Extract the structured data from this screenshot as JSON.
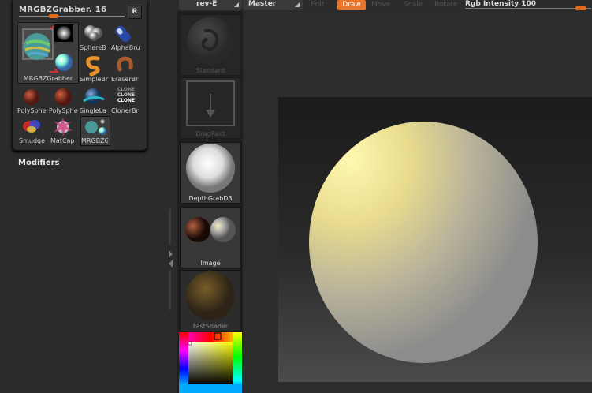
{
  "brush_panel": {
    "title": "MRGBZGrabber. 16",
    "r_button": "R",
    "items": [
      {
        "label": "MRGBZGrabber",
        "icon": "mrgbz-grabber-icon"
      },
      {
        "label": "SphereB",
        "icon": "sphere-brush-icon"
      },
      {
        "label": "AlphaBru",
        "icon": "alpha-brush-icon"
      },
      {
        "label": "SimpleBr",
        "icon": "simple-brush-icon"
      },
      {
        "label": "EraserBr",
        "icon": "eraser-brush-icon"
      },
      {
        "label": "PolySphe",
        "icon": "polysphere-icon"
      },
      {
        "label": "PolySphe",
        "icon": "polysphere-icon"
      },
      {
        "label": "SingleLa",
        "icon": "single-layer-icon"
      },
      {
        "label": "ClonerBr",
        "icon": "cloner-brush-icon"
      },
      {
        "label": "Smudge",
        "icon": "smudge-icon"
      },
      {
        "label": "MatCap",
        "icon": "matcap-icon"
      },
      {
        "label": "MRGBZG",
        "icon": "mrgbz-grabber-small-icon"
      }
    ],
    "clone_text": [
      "CLONE",
      "CLONE",
      "CLONE"
    ]
  },
  "modifiers_label": "Modifiers",
  "materials": {
    "dropdown": "rev-E",
    "items": [
      {
        "label": "Standard"
      },
      {
        "label": "DragRect"
      },
      {
        "label": "DepthGrabD3"
      },
      {
        "label": "Image"
      },
      {
        "label": "FastShader"
      }
    ]
  },
  "toolbar": {
    "master": "Master",
    "edit": "Edit",
    "draw": "Draw",
    "move": "Move",
    "scale": "Scale",
    "rotate": "Rotate",
    "rgb_intensity": "Rgb Intensity 100"
  },
  "colors": {
    "accent": "#e8752a",
    "panel": "#2e2e2e",
    "sphere_highlight": "#fff8b0"
  }
}
